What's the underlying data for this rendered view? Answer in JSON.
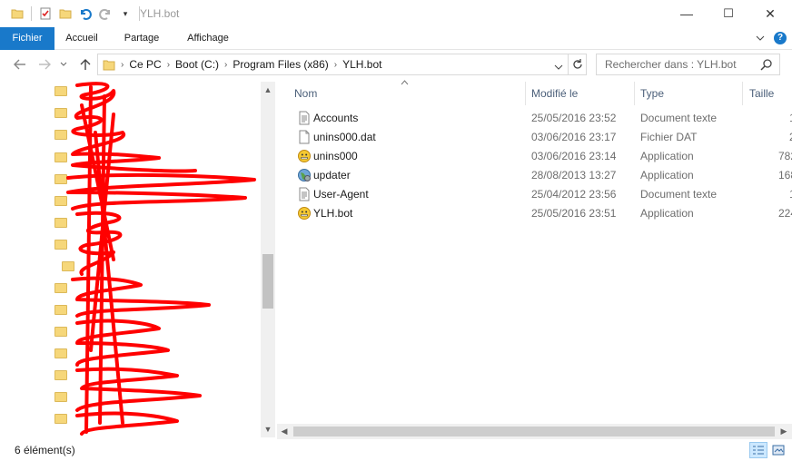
{
  "window": {
    "title": "YLH.bot",
    "minimize": "—",
    "maximize": "☐",
    "close": "✕"
  },
  "ribbon": {
    "tabs": [
      {
        "label": "Fichier"
      },
      {
        "label": "Accueil"
      },
      {
        "label": "Partage"
      },
      {
        "label": "Affichage"
      }
    ],
    "help": "?"
  },
  "address": {
    "path": [
      "Ce PC",
      "Boot (C:)",
      "Program Files (x86)",
      "YLH.bot"
    ],
    "search_placeholder": "Rechercher dans : YLH.bot"
  },
  "columns": {
    "name": "Nom",
    "date": "Modifié le",
    "type": "Type",
    "size": "Taille"
  },
  "files": [
    {
      "name": "Accounts",
      "date": "25/05/2016 23:52",
      "type": "Document texte",
      "size": "1",
      "icon": "text-file-icon"
    },
    {
      "name": "unins000.dat",
      "date": "03/06/2016 23:17",
      "type": "Fichier DAT",
      "size": "2",
      "icon": "blank-file-icon"
    },
    {
      "name": "unins000",
      "date": "03/06/2016 23:14",
      "type": "Application",
      "size": "782",
      "icon": "smiley-app-icon"
    },
    {
      "name": "updater",
      "date": "28/08/2013 13:27",
      "type": "Application",
      "size": "168",
      "icon": "globe-app-icon"
    },
    {
      "name": "User-Agent",
      "date": "25/04/2012 23:56",
      "type": "Document texte",
      "size": "1",
      "icon": "text-file-icon"
    },
    {
      "name": "YLH.bot",
      "date": "25/05/2016 23:51",
      "type": "Application",
      "size": "224",
      "icon": "smiley-app-icon"
    }
  ],
  "status": {
    "count": "6 élément(s)"
  },
  "colors": {
    "accent": "#1979ca",
    "scribble": "#ff0000"
  }
}
